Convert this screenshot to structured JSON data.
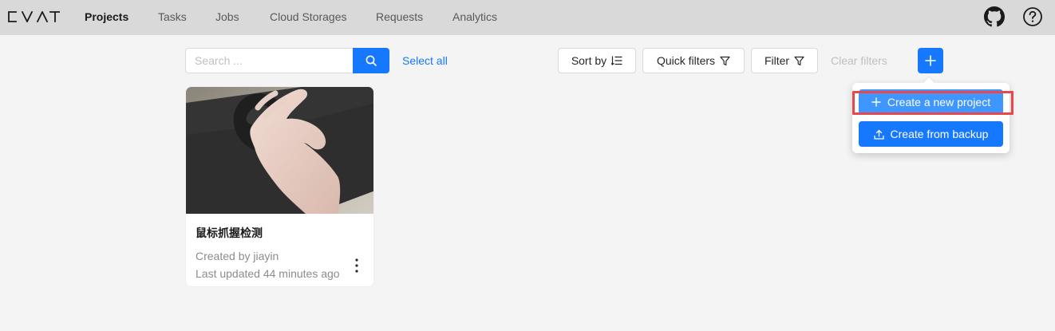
{
  "header": {
    "logo_alt": "CVAT",
    "nav": [
      {
        "label": "Projects",
        "active": true
      },
      {
        "label": "Tasks",
        "active": false
      },
      {
        "label": "Jobs",
        "active": false
      },
      {
        "label": "Cloud Storages",
        "active": false
      },
      {
        "label": "Requests",
        "active": false
      },
      {
        "label": "Analytics",
        "active": false
      }
    ],
    "icons": [
      "github-icon",
      "help-icon"
    ]
  },
  "toolbar": {
    "search_placeholder": "Search ...",
    "search_value": "",
    "select_all": "Select all",
    "sort_by": "Sort by",
    "quick_filters": "Quick filters",
    "filter": "Filter",
    "clear_filters": "Clear filters"
  },
  "create_menu": {
    "create_new_project": "Create a new project",
    "create_from_backup": "Create from backup",
    "highlighted_item": "Create a new project"
  },
  "projects": [
    {
      "title": "鼠标抓握检测",
      "created_by": "Created by jiayin",
      "last_updated": "Last updated 44 minutes ago"
    }
  ],
  "colors": {
    "accent": "#1677ff",
    "accent_light": "#4096ff",
    "header_bg": "#d9d9d9",
    "page_bg": "#f4f4f4",
    "highlight": "#e8484a"
  }
}
